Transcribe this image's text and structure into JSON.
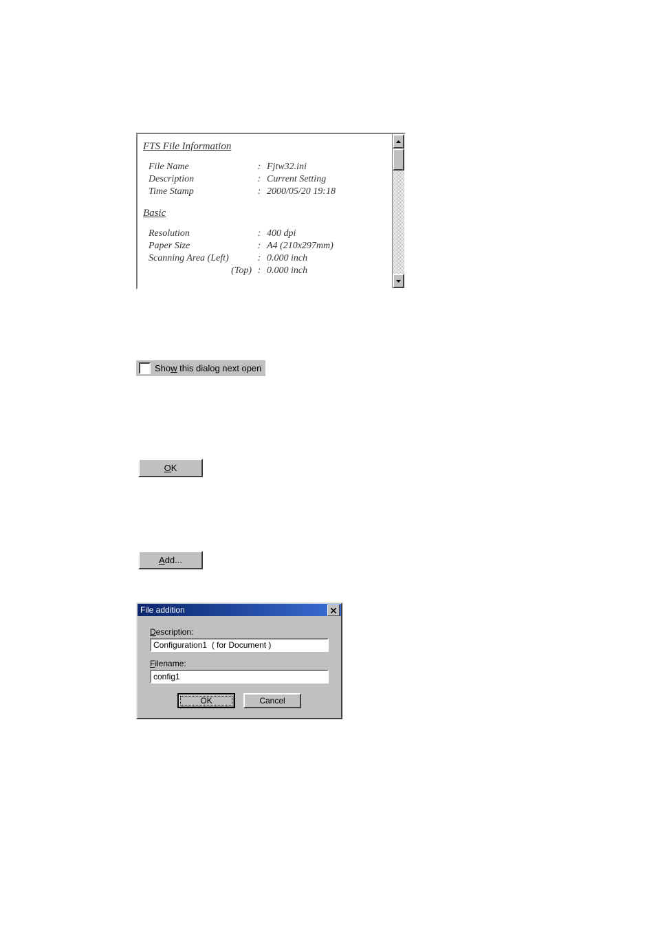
{
  "panel": {
    "section1_title": "FTS File Information",
    "rows1": [
      {
        "label": "File Name",
        "value": "Fjtw32.ini"
      },
      {
        "label": "Description",
        "value": "Current Setting"
      },
      {
        "label": "Time Stamp",
        "value": "2000/05/20 19:18"
      }
    ],
    "section2_title": "Basic",
    "rows2": [
      {
        "label": "Resolution",
        "value": "400 dpi"
      },
      {
        "label": "Paper Size",
        "value": "A4 (210x297mm)"
      },
      {
        "label": "Scanning Area (Left)",
        "value": "0.000 inch"
      },
      {
        "label": "(Top)",
        "value": "0.000 inch"
      }
    ]
  },
  "checkbox": {
    "prefix": "Sho",
    "hot": "w",
    "suffix": " this dialog next open"
  },
  "buttons": {
    "ok_hot": "O",
    "ok_rest": "K",
    "add_hot": "A",
    "add_rest": "dd..."
  },
  "dialog": {
    "title": "File addition",
    "desc_prefix": "",
    "desc_hot": "D",
    "desc_suffix": "escription:",
    "desc_value": "Configuration1  ( for Document )",
    "file_prefix": "",
    "file_hot": "F",
    "file_suffix": "ilename:",
    "file_value": "config1",
    "ok": "OK",
    "cancel": "Cancel"
  }
}
